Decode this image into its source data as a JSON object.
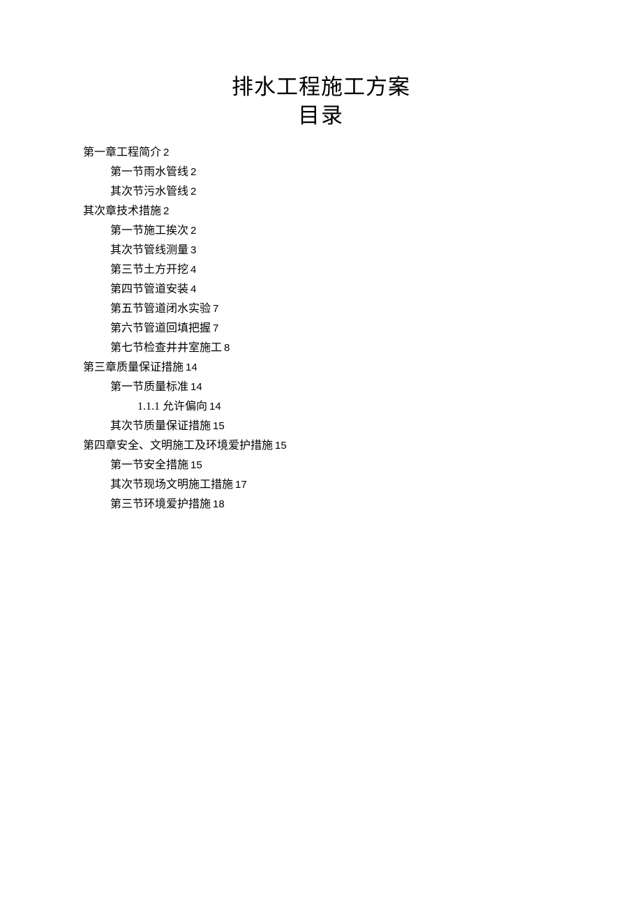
{
  "title": {
    "main": "排水工程施工方案",
    "sub": "目录"
  },
  "toc": [
    {
      "level": 0,
      "text": "第一章工程简介",
      "page": "2"
    },
    {
      "level": 1,
      "text": "第一节雨水管线",
      "page": "2"
    },
    {
      "level": 1,
      "text": "其次节污水管线",
      "page": "2"
    },
    {
      "level": 0,
      "text": "其次章技术措施",
      "page": "2"
    },
    {
      "level": 1,
      "text": "第一节施工挨次",
      "page": "2"
    },
    {
      "level": 1,
      "text": "其次节管线测量",
      "page": "3"
    },
    {
      "level": 1,
      "text": "第三节土方开挖",
      "page": "4"
    },
    {
      "level": 1,
      "text": "第四节管道安装",
      "page": "4"
    },
    {
      "level": 1,
      "text": "第五节管道闭水实验",
      "page": "7"
    },
    {
      "level": 1,
      "text": "第六节管道回填把握",
      "page": "7"
    },
    {
      "level": 1,
      "text": "第七节检查井井室施工",
      "page": "8"
    },
    {
      "level": 0,
      "text": "第三章质量保证措施",
      "page": "14"
    },
    {
      "level": 1,
      "text": "第一节质量标准",
      "page": "14"
    },
    {
      "level": 2,
      "text": "1.1.1 允许偏向",
      "page": "14"
    },
    {
      "level": 1,
      "text": "其次节质量保证措施",
      "page": "15"
    },
    {
      "level": 0,
      "text": "第四章安全、文明施工及环境爱护措施",
      "page": "15"
    },
    {
      "level": 1,
      "text": "第一节安全措施",
      "page": "15"
    },
    {
      "level": 1,
      "text": "其次节现场文明施工措施",
      "page": "17"
    },
    {
      "level": 1,
      "text": "第三节环境爱护措施",
      "page": "18"
    }
  ]
}
